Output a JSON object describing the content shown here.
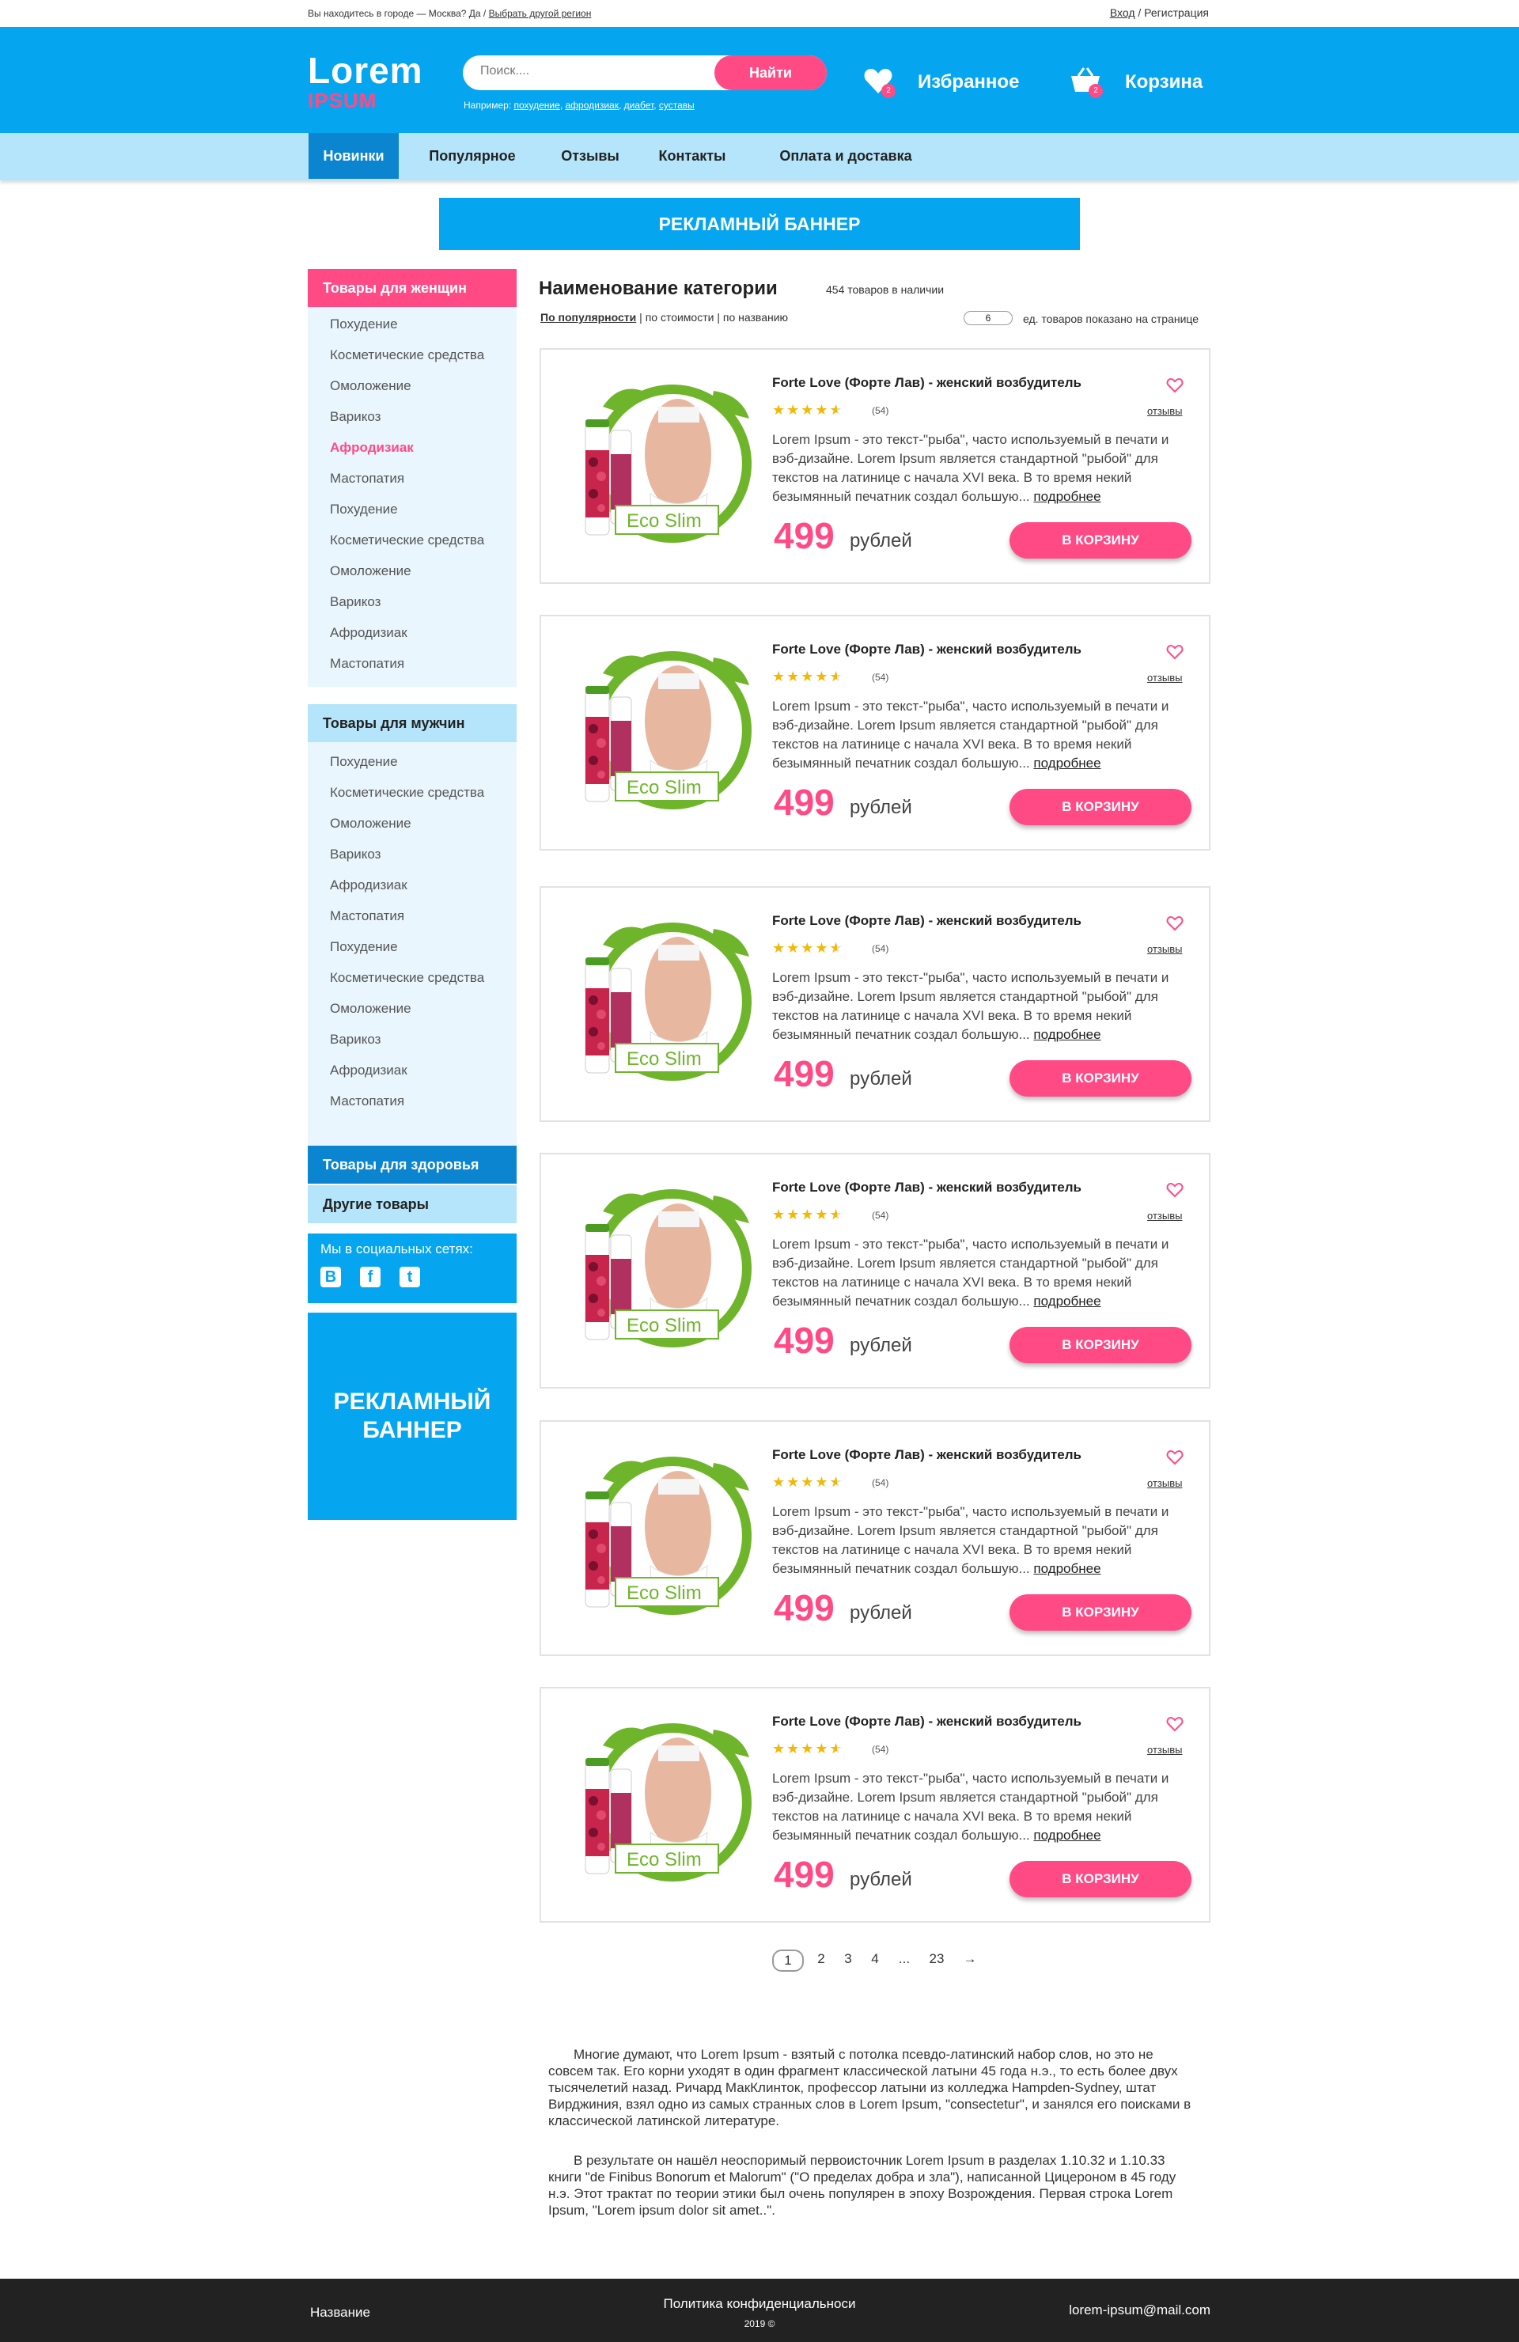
{
  "topbar": {
    "city_text": "Вы находитесь в городе — Москва? Да / ",
    "change_region": "Выбрать другой регион",
    "login": "Вход",
    "sep": " / ",
    "register": "Регистрация"
  },
  "header": {
    "logo_top": "Lorem",
    "logo_bottom": "IPSUM",
    "search_placeholder": "Поиск....",
    "search_button": "Найти",
    "hint_prefix": "Например: ",
    "hints": [
      "похудение",
      "афродизиак",
      "диабет",
      "суставы"
    ],
    "favorites_label": "Избранное",
    "favorites_count": "2",
    "cart_label": "Корзина",
    "cart_count": "2"
  },
  "nav": [
    "Новинки",
    "Популярное",
    "Отзывы",
    "Контакты",
    "Оплата и доставка"
  ],
  "banner_top": "РЕКЛАМНЫЙ БАННЕР",
  "sidebar": {
    "women_title": "Товары для женщин",
    "women_items": [
      "Похудение",
      "Косметические средства",
      "Омоложение",
      "Варикоз",
      "Афродизиак",
      "Мастопатия",
      "Похудение",
      "Косметические средства",
      "Омоложение",
      "Варикоз",
      "Афродизиак",
      "Мастопатия"
    ],
    "men_title": "Товары для мужчин",
    "men_items": [
      "Похудение",
      "Косметические средства",
      "Омоложение",
      "Варикоз",
      "Афродизиак",
      "Мастопатия",
      "Похудение",
      "Косметические средства",
      "Омоложение",
      "Варикоз",
      "Афродизиак",
      "Мастопатия"
    ],
    "health_title": "Товары для здоровья",
    "other_title": "Другие товары",
    "social_title": "Мы в социальных сетях:",
    "social_icons": [
      "vk-icon",
      "facebook-icon",
      "twitter-icon"
    ],
    "banner_line1": "РЕКЛАМНЫЙ",
    "banner_line2": "БАННЕР"
  },
  "category": {
    "title": "Наименование категории",
    "count": "454 товаров в наличии",
    "sort_popular": "По популярности",
    "sort_price": "по стоимости",
    "sort_name": "по названию",
    "per_page": "6",
    "per_page_label": "ед. товаров показано на странице"
  },
  "product": {
    "title": "Forte Love (Форте Лав) - женский возбудитель",
    "rating_count": "(54)",
    "reviews": "отзывы",
    "description": "Lorem Ipsum - это текст-\"рыба\", часто используемый в печати и вэб-дизайне. Lorem Ipsum является стандартной \"рыбой\" для текстов на латинице с начала XVI века. В то время некий безымянный печатник создал большую...",
    "more": "подробнее",
    "price": "499",
    "currency": "рублей",
    "cart_button": "В КОРЗИНУ",
    "image_brand": "Eco Slim",
    "rating": 4.5
  },
  "pagination": [
    "1",
    "2",
    "3",
    "4",
    "...",
    "23",
    "→"
  ],
  "seo": [
    "Многие думают, что Lorem Ipsum - взятый с потолка псевдо-латинский набор слов, но это не совсем так. Его корни уходят в один фрагмент классической латыни 45 года н.э., то есть более двух тысячелетий назад. Ричард МакКлинток, профессор латыни из колледжа Hampden-Sydney, штат Вирджиния, взял одно из самых странных слов в Lorem Ipsum, \"consectetur\", и занялся его поисками в классической латинской литературе.",
    "В результате он нашёл неоспоримый первоисточник Lorem Ipsum в разделах 1.10.32 и 1.10.33 книги \"de Finibus Bonorum et Malorum\" (\"О пределах добра и зла\"), написанной Цицероном в 45 году н.э. Этот трактат по теории этики был очень популярен в эпоху Возрождения. Первая строка Lorem Ipsum, \"Lorem ipsum dolor sit amet..\"."
  ],
  "footer": {
    "name": "Название",
    "privacy": "Политика конфиденциальноси",
    "year": "2019 ©",
    "email": "lorem-ipsum@mail.com"
  },
  "colors": {
    "brand_blue": "#06a5ef",
    "pink": "#ff4a86",
    "light_blue": "#b5e5fb",
    "dark_blue": "#0b85cf"
  }
}
